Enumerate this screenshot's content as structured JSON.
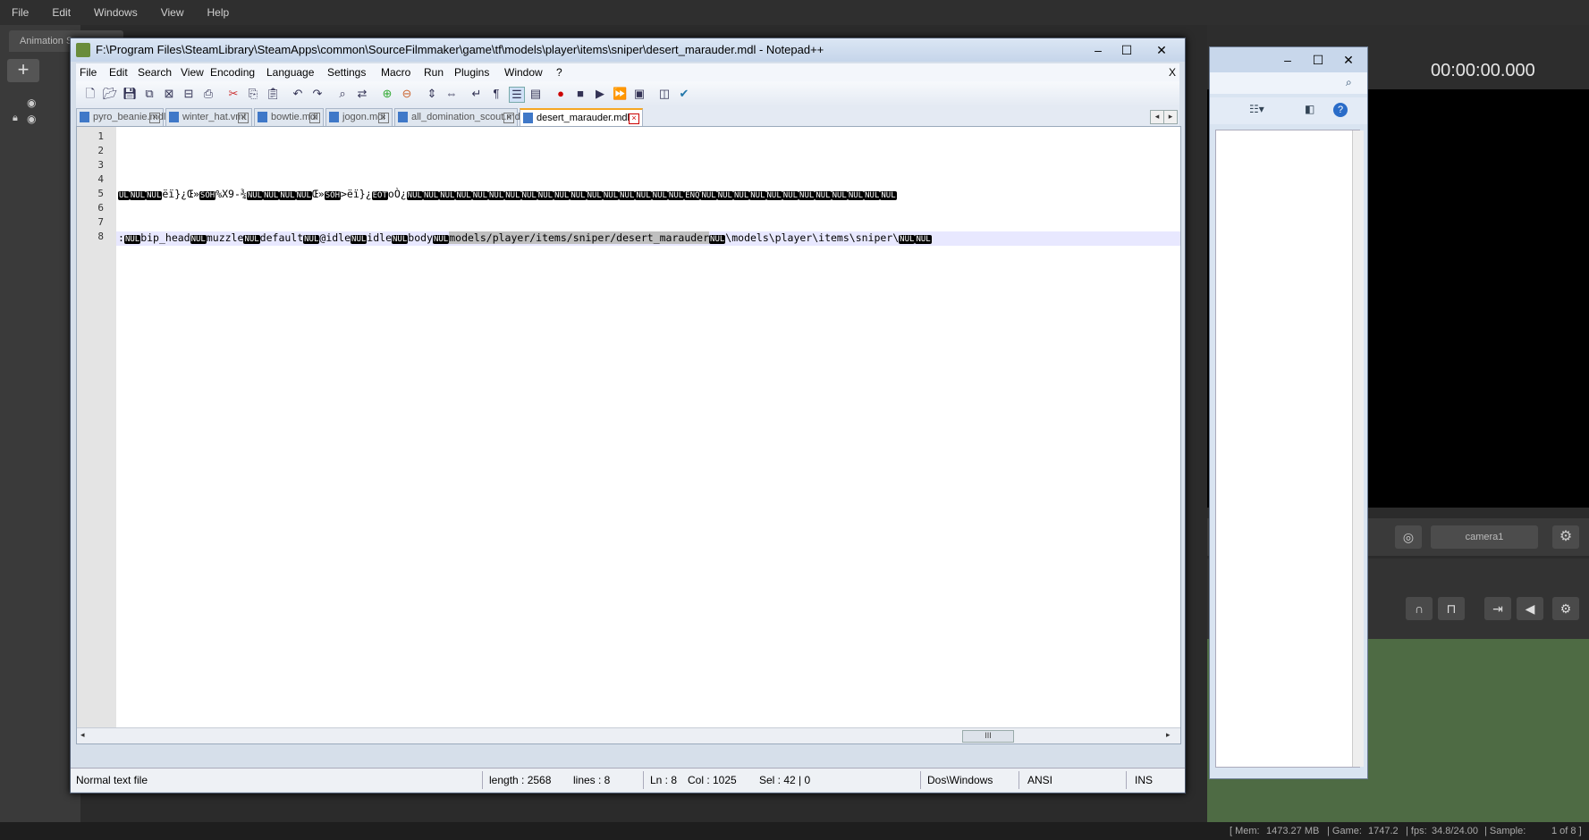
{
  "sfm": {
    "menu": [
      "File",
      "Edit",
      "Windows",
      "View",
      "Help"
    ],
    "tab_label": "Animation S",
    "add_label": "+",
    "time": "00:00:00.000",
    "camera": "camera1",
    "status": {
      "mem": "[ Mem:",
      "mem_val": "1473.27 MB",
      "game": "| Game:",
      "game_val": "1747.2",
      "fps": "| fps:",
      "fps_val": "34.8/24.00",
      "sample": "| Sample:",
      "page": "1 of 8 ]"
    }
  },
  "notepad": {
    "title": "F:\\Program Files\\SteamLibrary\\SteamApps\\common\\SourceFilmmaker\\game\\tf\\models\\player\\items\\sniper\\desert_marauder.mdl - Notepad++",
    "menu": [
      "File",
      "Edit",
      "Search",
      "View",
      "Encoding",
      "Language",
      "Settings",
      "Macro",
      "Run",
      "Plugins",
      "Window",
      "?"
    ],
    "menu_close": "X",
    "tabs": [
      "pyro_beanie.mdl",
      "winter_hat.vmt",
      "bowtie.mdl",
      "jogon.mdl",
      "all_domination_scout.mdl",
      "desert_marauder.mdl"
    ],
    "line_numbers": [
      "1",
      "2",
      "3",
      "4",
      "5",
      "6",
      "7",
      "8"
    ],
    "line5": {
      "prefix": "UL",
      "n1": "NUL",
      "n2": "NUL",
      "t1": "ëï}¿Œ»",
      "soh1": "SOH",
      "t2": "%X9-¾",
      "n3": "NUL",
      "n4": "NUL",
      "n5": "NUL",
      "n6": "NUL",
      "t3": "Œ»",
      "soh2": "SOH",
      "t4": ">ëï}¿",
      "eot": "EOT",
      "t5": "oÒ¿",
      "enq": "ENQ",
      "nul_word": "NUL"
    },
    "line8": {
      "lead": ":",
      "n1": "NUL",
      "t1": "bip_head",
      "n2": "NUL",
      "t2": "muzzle",
      "n3": "NUL",
      "t3": "default",
      "n4": "NUL",
      "t4": "@idle",
      "n5": "NUL",
      "t5": "idle",
      "n6": "NUL",
      "t6": "body",
      "n7": "NUL",
      "sel": "models/player/items/sniper/desert_marauder",
      "n8": "NUL",
      "t7": "\\models\\player\\items\\sniper\\",
      "n9": "NUL",
      "n10": "NUL"
    },
    "hscroll_thumb": "III",
    "status": {
      "type": "Normal text file",
      "length": "length : 2568",
      "lines": "lines : 8",
      "ln": "Ln : 8",
      "col": "Col : 1025",
      "sel": "Sel : 42 | 0",
      "eol": "Dos\\Windows",
      "enc": "ANSI",
      "mode": "INS"
    }
  }
}
